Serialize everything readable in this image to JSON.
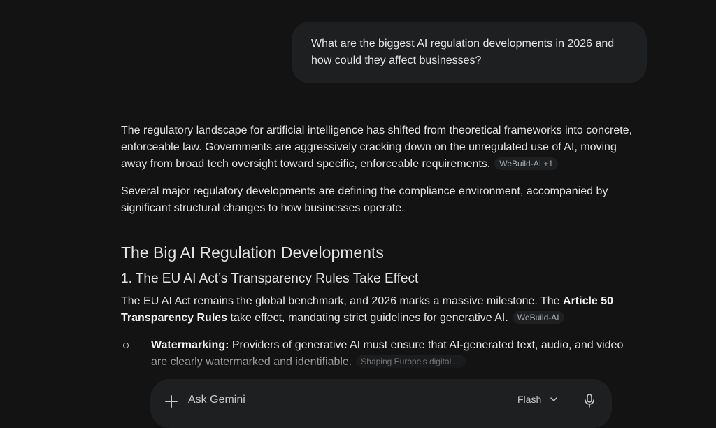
{
  "user_message": {
    "line1": "What are the biggest AI regulation developments in 2026 and",
    "line2": "how could they affect businesses?"
  },
  "response": {
    "p1": "The regulatory landscape for artificial intelligence has shifted from theoretical frameworks into concrete, enforceable law. Governments are aggressively cracking down on the unregulated use of AI, moving away from broad tech oversight toward specific, enforceable requirements.",
    "p1_source": "WeBuild-AI +1",
    "p2": "Several major regulatory developments are defining the compliance environment, accompanied by significant structural changes to how businesses operate.",
    "heading": "The Big AI Regulation Developments",
    "subheading": "1. The EU AI Act’s Transparency Rules Take Effect",
    "p3_a": "The EU AI Act remains the global benchmark, and 2026 marks a massive milestone. The ",
    "p3_bold": "Article 50 Transparency Rules",
    "p3_b": " take effect, mandating strict guidelines for generative AI.",
    "p3_source": "WeBuild-AI",
    "bullet1_bold": "Watermarking:",
    "bullet1_text": " Providers of generative AI must ensure that AI-generated text, audio, and video are clearly watermarked and identifiable.",
    "bullet1_source": "Shaping Europe's digital ..."
  },
  "input_bar": {
    "placeholder": "Ask Gemini",
    "model": "Flash",
    "icons": [
      "plus-icon",
      "chevron-down-icon",
      "microphone-icon"
    ]
  }
}
